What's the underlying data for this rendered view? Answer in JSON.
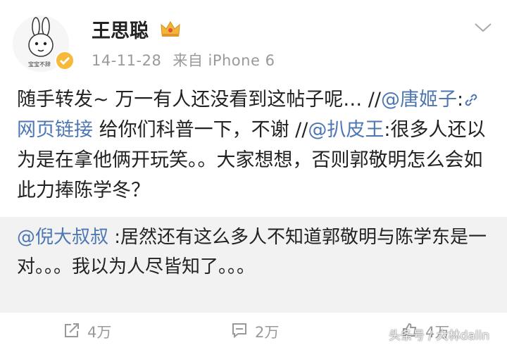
{
  "post": {
    "author": "王思聪",
    "avatar_caption": "宝宝不辞",
    "date": "14-11-28",
    "source": "来自 iPhone 6",
    "text": {
      "p1": "随手转发~ 万一有人还没看到这帖子呢… //",
      "mention1": "@唐姬子",
      "p2": ":",
      "link_icon": "link-icon",
      "link_label": "网页链接",
      "p3": " 给你们科普一下，不谢 //",
      "mention2": "@扒皮王",
      "p4": ":很多人还以为是在拿他俩开玩笑。。大家想想，否则郭敬明怎么会如此力捧陈学冬？"
    }
  },
  "quoted": {
    "mention": "@倪大叔叔",
    "text": " :居然还有这么多人不知道郭敬明与陈学东是一对。。。我以为人尽皆知了。。。"
  },
  "footer": {
    "repost_count": "4万",
    "comment_count": "2万",
    "like_count": "4万"
  },
  "watermark": "头条号 / 大林dalin",
  "colors": {
    "link": "#4d77b3",
    "quote_bg": "#f2f2f2",
    "meta": "#9a9a9a"
  },
  "icons": [
    "crown-icon",
    "chevron-down-icon",
    "repost-icon",
    "comment-icon",
    "like-icon",
    "verified-badge-icon"
  ]
}
